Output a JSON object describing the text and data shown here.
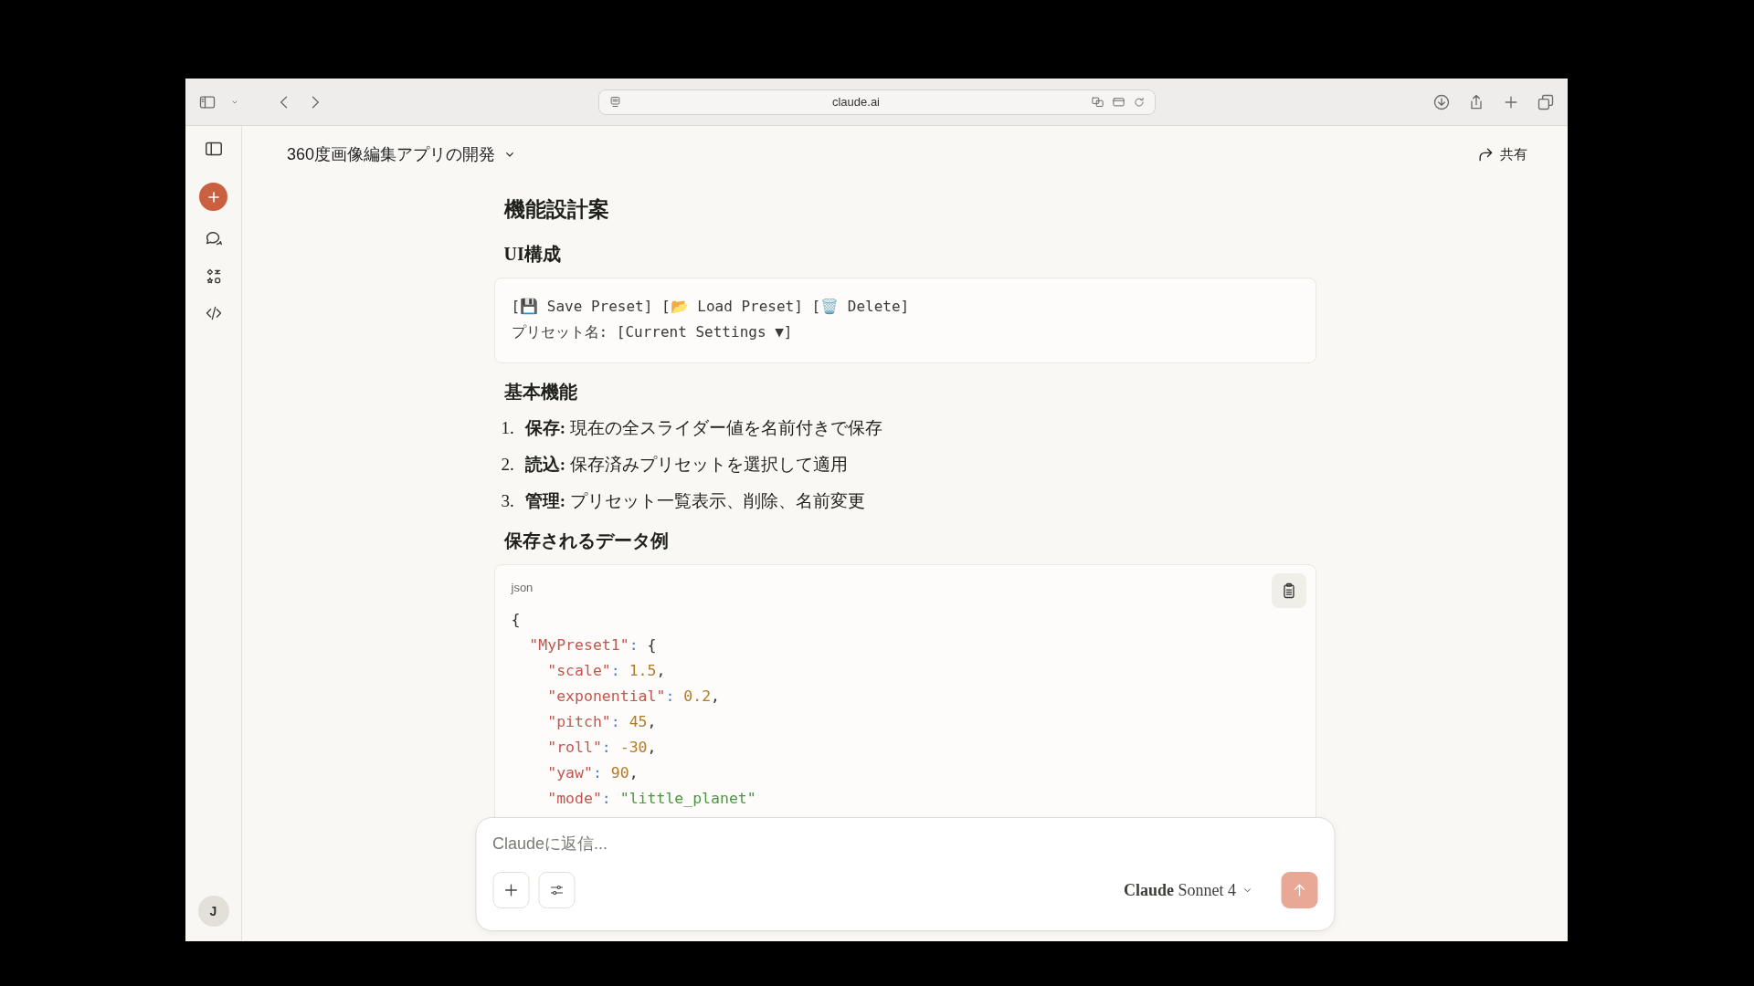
{
  "browser": {
    "url": "claude.ai"
  },
  "chat": {
    "title": "360度画像編集アプリの開発",
    "share": "共有"
  },
  "sidebar": {
    "avatar": "J"
  },
  "content": [
    {
      "kind": "title",
      "text": "機能設計案"
    },
    {
      "kind": "heading",
      "text": "UI構成"
    },
    {
      "kind": "plain_code",
      "lines": [
        "[💾 Save Preset] [📂 Load Preset] [🗑️ Delete]",
        "プリセット名: [Current Settings ▼]"
      ]
    },
    {
      "kind": "heading",
      "text": "基本機能"
    },
    {
      "kind": "list",
      "items": [
        {
          "number": "1.",
          "text": "**保存:** 現在の全スライダー値を名前付きで保存"
        },
        {
          "number": "2.",
          "text": "**読込:** 保存済みプリセットを選択して適用"
        },
        {
          "number": "3.",
          "text": "**管理:** プリセット一覧表示、削除、名前変更"
        }
      ]
    },
    {
      "kind": "heading",
      "text": "保存されるデータ例"
    },
    {
      "kind": "code_block",
      "language": "json",
      "lines": [
        [
          {
            "kind": "punct",
            "text": "{"
          }
        ],
        [
          {
            "kind": "key",
            "text": "  \"MyPreset1\""
          },
          {
            "kind": "colon",
            "text": ": "
          },
          {
            "kind": "punct",
            "text": "{"
          }
        ],
        [
          {
            "kind": "key",
            "text": "    \"scale\""
          },
          {
            "kind": "colon",
            "text": ": "
          },
          {
            "kind": "number",
            "text": "1.5"
          },
          {
            "kind": "punct",
            "text": ","
          }
        ],
        [
          {
            "kind": "key",
            "text": "    \"exponential\""
          },
          {
            "kind": "colon",
            "text": ": "
          },
          {
            "kind": "number",
            "text": "0.2"
          },
          {
            "kind": "punct",
            "text": ","
          }
        ],
        [
          {
            "kind": "key",
            "text": "    \"pitch\""
          },
          {
            "kind": "colon",
            "text": ": "
          },
          {
            "kind": "number",
            "text": "45"
          },
          {
            "kind": "punct",
            "text": ","
          }
        ],
        [
          {
            "kind": "key",
            "text": "    \"roll\""
          },
          {
            "kind": "colon",
            "text": ": "
          },
          {
            "kind": "number",
            "text": "-30"
          },
          {
            "kind": "punct",
            "text": ","
          }
        ],
        [
          {
            "kind": "key",
            "text": "    \"yaw\""
          },
          {
            "kind": "colon",
            "text": ": "
          },
          {
            "kind": "number",
            "text": "90"
          },
          {
            "kind": "punct",
            "text": ","
          }
        ],
        [
          {
            "kind": "key",
            "text": "    \"mode\""
          },
          {
            "kind": "colon",
            "text": ": "
          },
          {
            "kind": "string",
            "text": "\"little_planet\""
          }
        ]
      ]
    }
  ],
  "composer": {
    "placeholder": "Claudeに返信...",
    "model": "**Claude** Sonnet 4"
  }
}
